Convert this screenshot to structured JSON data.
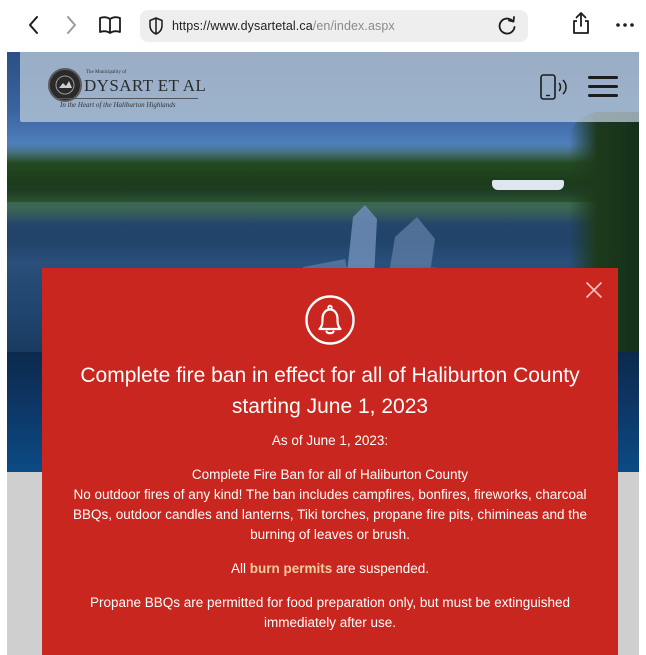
{
  "browser": {
    "url_host": "https://www.dysartetal.ca",
    "url_path": "/en/index.aspx"
  },
  "site": {
    "logo_small": "The Municipality of",
    "logo_name": "DYSART ET AL",
    "logo_tagline": "In the Heart of the Haliburton Highlands"
  },
  "alert": {
    "title": "Complete fire ban in effect for all of Haliburton County starting June 1, 2023",
    "as_of": "As of June 1, 2023:",
    "ban_heading": "Complete Fire Ban for all of Haliburton County",
    "ban_details": "No outdoor fires of any kind! The ban includes campfires, bonfires, fireworks, charcoal BBQs, outdoor candles and lanterns, Tiki torches, propane fire pits, chimineas and the burning of leaves or brush.",
    "permits_before": "All ",
    "permits_link": "burn permits",
    "permits_after": " are suspended.",
    "bbq_note": "Propane BBQs are permitted for food preparation only, but must be extinguished immediately after use."
  },
  "colors": {
    "alert_background": "#c8261e",
    "link_color": "#f5cba0"
  },
  "icons": {
    "back": "chevron-left-icon",
    "forward": "chevron-right-icon",
    "reader": "book-icon",
    "shield": "shield-icon",
    "reload": "reload-icon",
    "share": "share-icon",
    "more": "ellipsis-icon",
    "phone": "phone-speaker-icon",
    "menu": "hamburger-menu-icon",
    "alert": "bell-icon",
    "close": "close-icon"
  }
}
